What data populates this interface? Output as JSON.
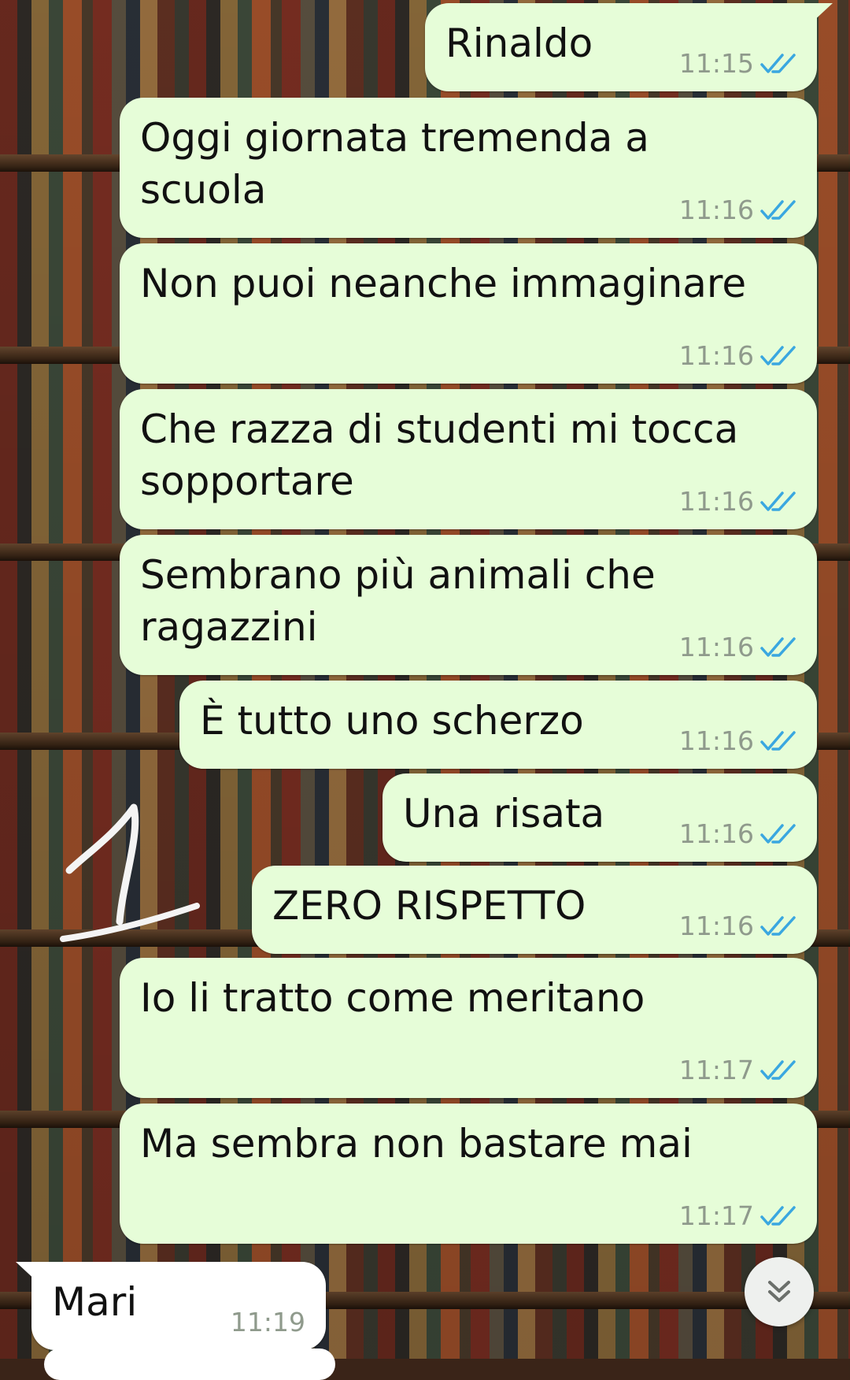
{
  "colors": {
    "outgoing_bubble": "#e6fdd8",
    "incoming_bubble": "#ffffff",
    "read_ticks": "#3aa7e0",
    "timestamp": "#8f9a8c"
  },
  "messages": [
    {
      "text": "Rinaldo",
      "time": "11:15",
      "direction": "outgoing",
      "status": "read"
    },
    {
      "text": "Oggi giornata tremenda a\nscuola",
      "time": "11:16",
      "direction": "outgoing",
      "status": "read"
    },
    {
      "text": "Non puoi neanche immaginare",
      "time": "11:16",
      "direction": "outgoing",
      "status": "read"
    },
    {
      "text": "Che razza di studenti mi tocca\nsopportare",
      "time": "11:16",
      "direction": "outgoing",
      "status": "read"
    },
    {
      "text": "Sembrano più animali che\nragazzini",
      "time": "11:16",
      "direction": "outgoing",
      "status": "read"
    },
    {
      "text": "È tutto uno scherzo",
      "time": "11:16",
      "direction": "outgoing",
      "status": "read"
    },
    {
      "text": "Una risata",
      "time": "11:16",
      "direction": "outgoing",
      "status": "read"
    },
    {
      "text": "ZERO RISPETTO",
      "time": "11:16",
      "direction": "outgoing",
      "status": "read"
    },
    {
      "text": "Io li tratto come meritano",
      "time": "11:17",
      "direction": "outgoing",
      "status": "read"
    },
    {
      "text": "Ma sembra non bastare mai",
      "time": "11:17",
      "direction": "outgoing",
      "status": "read"
    },
    {
      "text": "Mari",
      "time": "11:19",
      "direction": "incoming",
      "status": ""
    }
  ],
  "scroll_down_icon": "double-chevron-down-icon",
  "annotation_icon": "handwritten-number-one-icon"
}
